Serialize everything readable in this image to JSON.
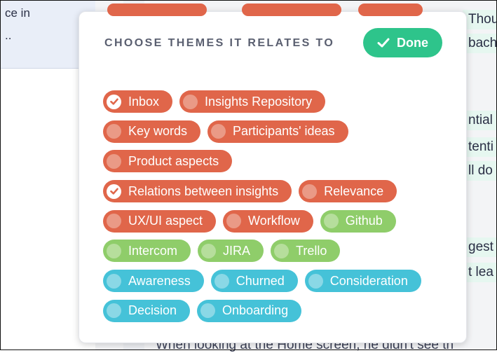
{
  "background": {
    "left_panel_lines": [
      "ce in",
      ".."
    ],
    "right_edge_lines": [
      "Thou",
      "bach",
      "ntial f",
      "tenti",
      "ll do",
      "gest",
      "t lea"
    ],
    "bottom_line": "When looking at the Home screen, he didn't see th"
  },
  "modal": {
    "title": "CHOOSE THEMES IT RELATES TO",
    "done_label": "Done"
  },
  "colors": {
    "orange": "#e0664a",
    "green": "#8fcd6a",
    "teal": "#45c2d8",
    "done": "#2ec48b"
  },
  "tag_rows": [
    [
      {
        "label": "Inbox",
        "color": "orange",
        "checked": true
      },
      {
        "label": "Insights Repository",
        "color": "orange",
        "checked": false
      }
    ],
    [
      {
        "label": "Key words",
        "color": "orange",
        "checked": false
      },
      {
        "label": "Participants' ideas",
        "color": "orange",
        "checked": false
      }
    ],
    [
      {
        "label": "Product aspects",
        "color": "orange",
        "checked": false
      }
    ],
    [
      {
        "label": "Relations between insights",
        "color": "orange",
        "checked": true
      },
      {
        "label": "Relevance",
        "color": "orange",
        "checked": false
      }
    ],
    [
      {
        "label": "UX/UI aspect",
        "color": "orange",
        "checked": false
      },
      {
        "label": "Workflow",
        "color": "orange",
        "checked": false
      },
      {
        "label": "Github",
        "color": "green",
        "checked": false
      }
    ],
    [
      {
        "label": "Intercom",
        "color": "green",
        "checked": false
      },
      {
        "label": "JIRA",
        "color": "green",
        "checked": false
      },
      {
        "label": "Trello",
        "color": "green",
        "checked": false
      }
    ],
    [
      {
        "label": "Awareness",
        "color": "teal",
        "checked": false
      },
      {
        "label": "Churned",
        "color": "teal",
        "checked": false
      },
      {
        "label": "Consideration",
        "color": "teal",
        "checked": false
      }
    ],
    [
      {
        "label": "Decision",
        "color": "teal",
        "checked": false
      },
      {
        "label": "Onboarding",
        "color": "teal",
        "checked": false
      }
    ]
  ]
}
